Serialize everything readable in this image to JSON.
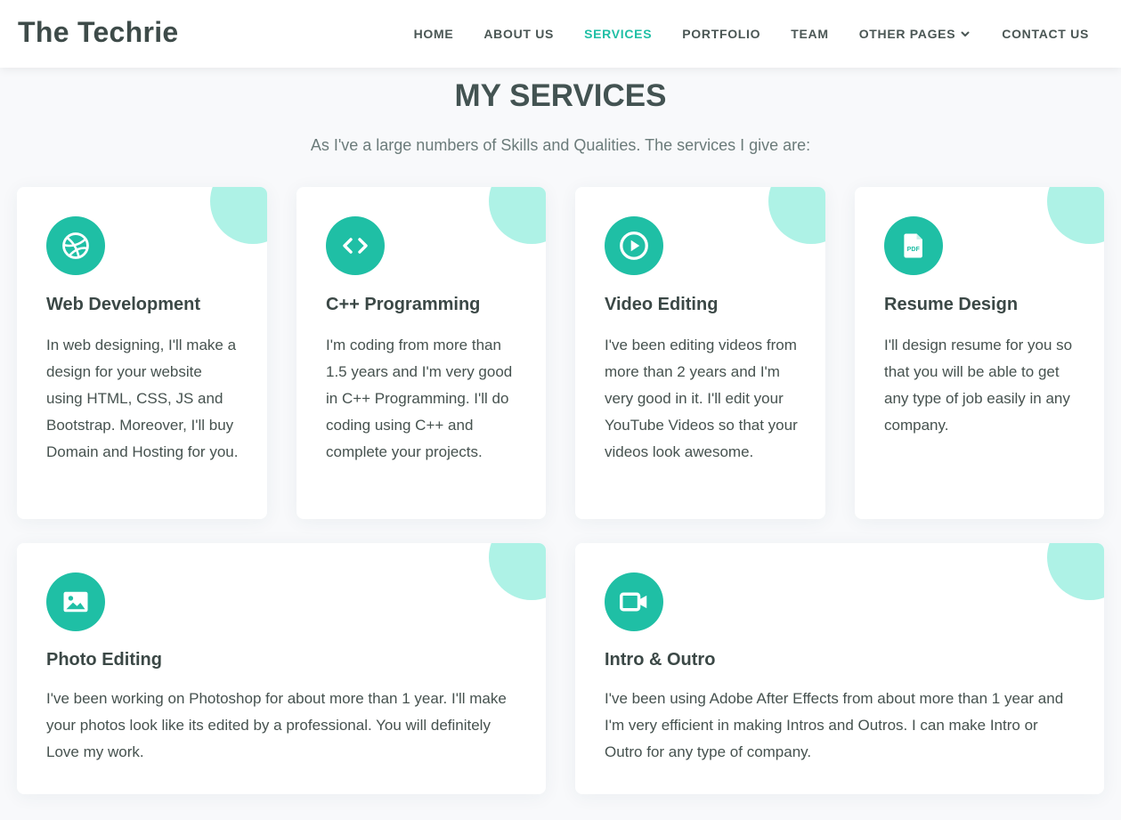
{
  "brand": "The Techrie",
  "nav": {
    "home": "HOME",
    "about": "ABOUT US",
    "services": "SERVICES",
    "portfolio": "PORTFOLIO",
    "team": "TEAM",
    "other": "OTHER PAGES",
    "contact": "CONTACT US"
  },
  "section": {
    "title": "MY SERVICES",
    "subtitle": "As I've a large numbers of Skills and Qualities. The services I give are:"
  },
  "services": [
    {
      "icon": "dribbble-icon",
      "title": "Web Development",
      "text": "In web designing, I'll make a design for your website using HTML, CSS, JS and Bootstrap. Moreover, I'll buy Domain and Hosting for you."
    },
    {
      "icon": "code-icon",
      "title": "C++ Programming",
      "text": "I'm coding from more than 1.5 years and I'm very good in C++ Programming. I'll do coding using C++ and complete your projects."
    },
    {
      "icon": "play-circle-icon",
      "title": "Video Editing",
      "text": "I've been editing videos from more than 2 years and I'm very good in it. I'll edit your YouTube Videos so that your videos look awesome."
    },
    {
      "icon": "pdf-file-icon",
      "title": "Resume Design",
      "text": "I'll design resume for you so that you will be able to get any type of job easily in any company."
    },
    {
      "icon": "image-icon",
      "title": "Photo Editing",
      "text": "I've been working on Photoshop for about more than 1 year. I'll make your photos look like its edited by a professional. You will definitely Love my work."
    },
    {
      "icon": "video-camera-icon",
      "title": "Intro & Outro",
      "text": "I've been using Adobe After Effects from about more than 1 year and I'm very efficient in making Intros and Outros. I can make Intro or Outro for any type of company."
    }
  ],
  "colors": {
    "accent": "#1fbfa5",
    "corner": "#aef2e6",
    "heading": "#435352"
  },
  "pdf_label": "PDF"
}
